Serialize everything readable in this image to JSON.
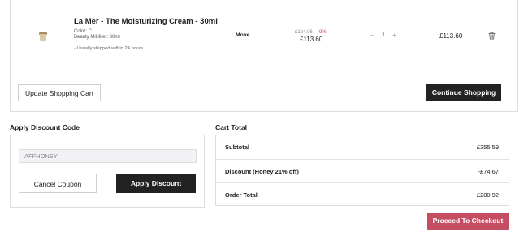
{
  "product": {
    "name": "La Mer - The Moisturizing Cream - 30ml",
    "option_color": "Color: C",
    "option_size": "Beauty Milliliter: 30ml",
    "shipping_note": "- Usually shipped within 24 hours",
    "move_label": "Move",
    "price_original": "£124.06",
    "price_discount": "-9%",
    "price_current": "£113.60",
    "quantity": "1",
    "qty_minus": "−",
    "qty_plus": "+",
    "row_total": "£113.60",
    "thumbnail_icon": "cream-jar-icon",
    "delete_icon": "trash-icon"
  },
  "cart_actions": {
    "update_label": "Update Shopping Cart",
    "continue_label": "Continue Shopping"
  },
  "discount": {
    "title": "Apply Discount Code",
    "coupon_value": "AFFHONEY",
    "cancel_label": "Cancel Coupon",
    "apply_label": "Apply Discount"
  },
  "cart_total": {
    "title": "Cart Total",
    "rows": [
      {
        "label": "Subtotal",
        "value": "£355.59"
      },
      {
        "label": "Discount (Honey 21% off)",
        "value": "-£74.67"
      },
      {
        "label": "Order Total",
        "value": "£280.92"
      }
    ]
  },
  "checkout_label": "Proceed To Checkout",
  "colors": {
    "accent_dark": "#222222",
    "checkout": "#c44d62",
    "discount_red": "#d0425b"
  }
}
